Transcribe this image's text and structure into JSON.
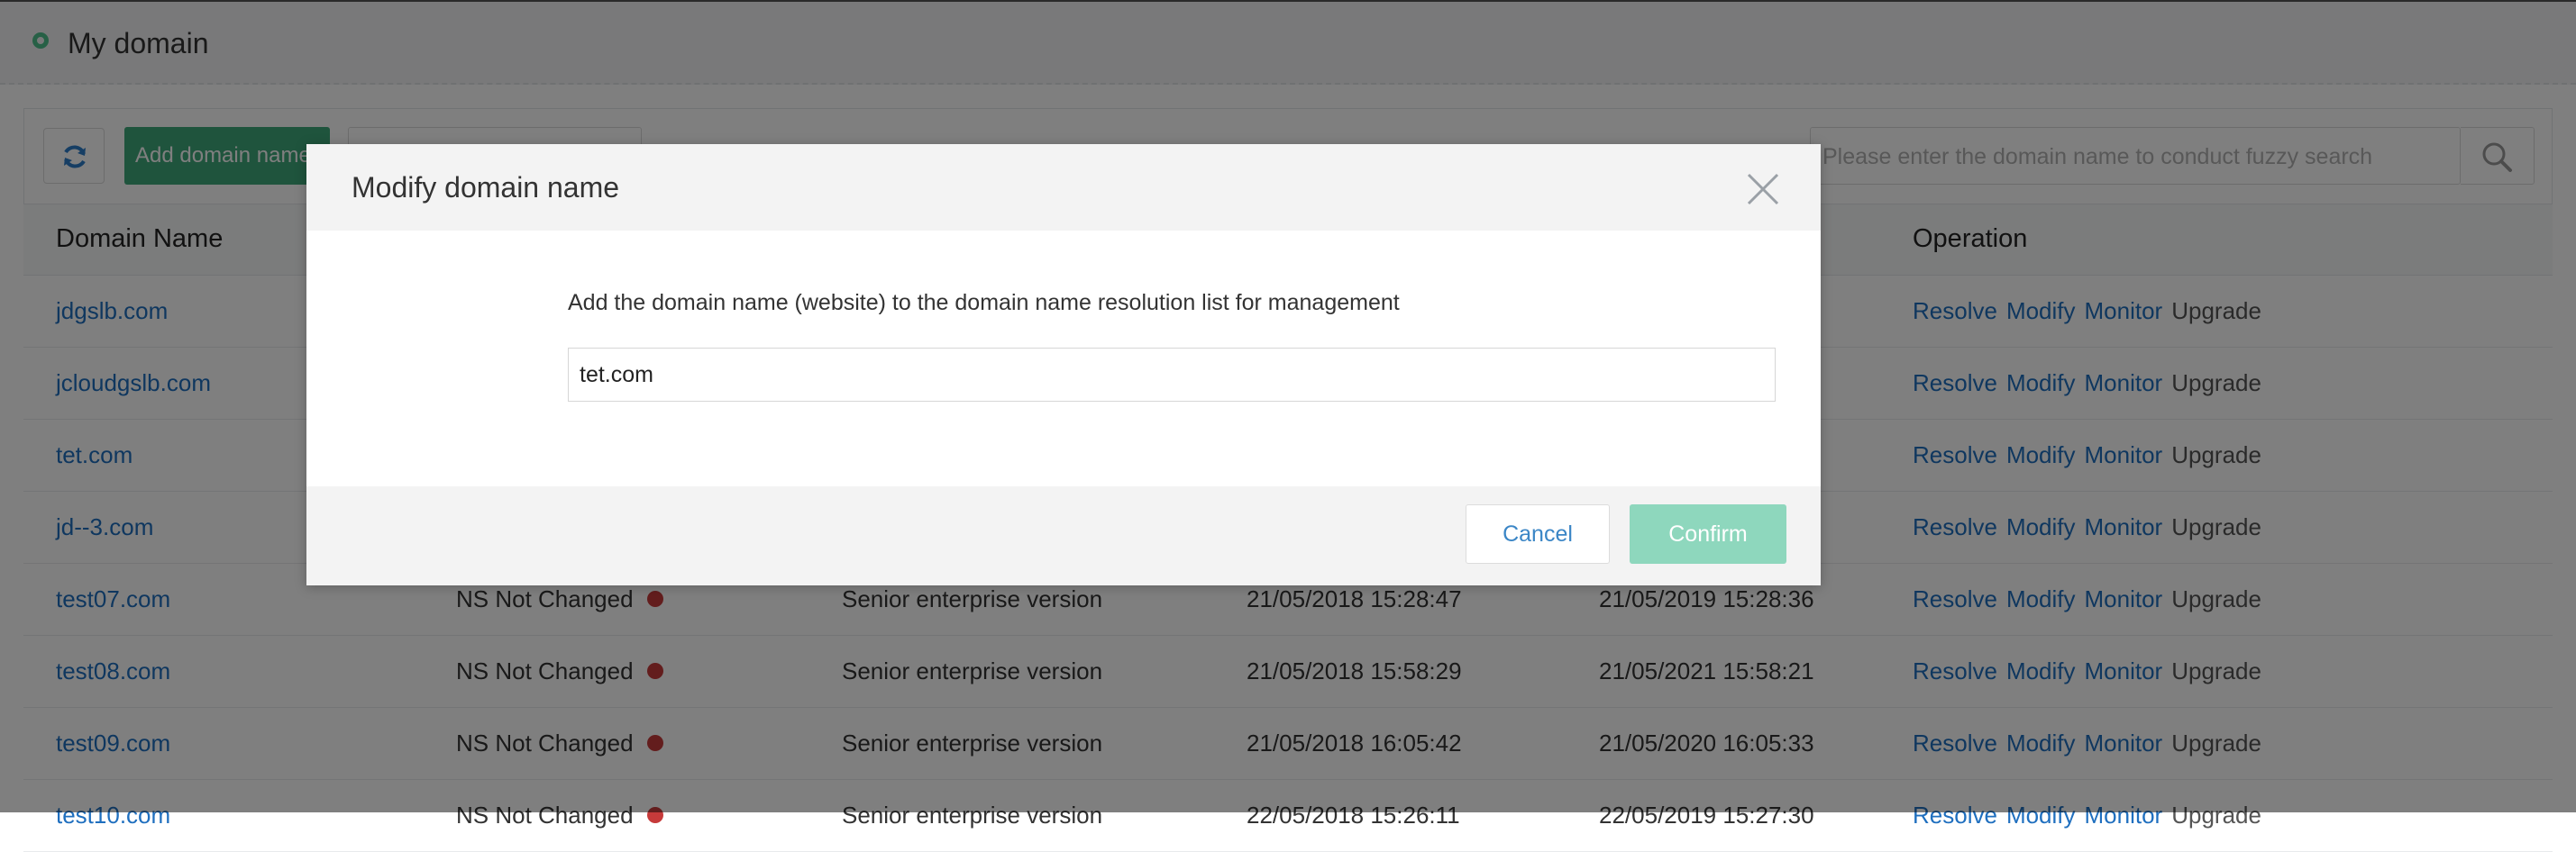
{
  "page": {
    "title": "My domain"
  },
  "toolbar": {
    "add_label": "Add domain name",
    "filter_value": "",
    "search_placeholder": "Please enter the domain name to conduct fuzzy search"
  },
  "table": {
    "headers": {
      "domain": "Domain Name",
      "operation": "Operation"
    },
    "ops": {
      "resolve": "Resolve",
      "modify": "Modify",
      "monitor": "Monitor",
      "upgrade": "Upgrade"
    },
    "rows": [
      {
        "domain": "jdgslb.com",
        "status": "",
        "version": "",
        "created": "",
        "expires": ""
      },
      {
        "domain": "jcloudgslb.com",
        "status": "",
        "version": "",
        "created": "",
        "expires": ""
      },
      {
        "domain": "tet.com",
        "status": "",
        "version": "",
        "created": "",
        "expires": ""
      },
      {
        "domain": "jd--3.com",
        "status": "",
        "version": "",
        "created": "",
        "expires": ""
      },
      {
        "domain": "test07.com",
        "status": "NS Not Changed",
        "version": "Senior enterprise version",
        "created": "21/05/2018 15:28:47",
        "expires": "21/05/2019 15:28:36"
      },
      {
        "domain": "test08.com",
        "status": "NS Not Changed",
        "version": "Senior enterprise version",
        "created": "21/05/2018 15:58:29",
        "expires": "21/05/2021 15:58:21"
      },
      {
        "domain": "test09.com",
        "status": "NS Not Changed",
        "version": "Senior enterprise version",
        "created": "21/05/2018 16:05:42",
        "expires": "21/05/2020 16:05:33"
      },
      {
        "domain": "test10.com",
        "status": "NS Not Changed",
        "version": "Senior enterprise version",
        "created": "22/05/2018 15:26:11",
        "expires": "22/05/2019 15:27:30"
      }
    ]
  },
  "modal": {
    "title": "Modify domain name",
    "description": "Add the domain name (website) to the domain name resolution list for management",
    "input_value": "tet.com",
    "cancel_label": "Cancel",
    "confirm_label": "Confirm"
  },
  "colors": {
    "brand_green": "#3fa87a",
    "confirm_disabled": "#8ed7bd",
    "link_blue": "#1f6fbf",
    "status_red": "#c63a3a"
  }
}
